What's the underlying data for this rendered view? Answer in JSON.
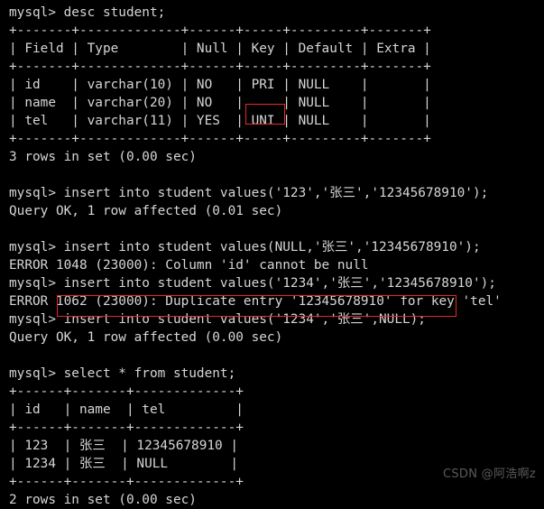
{
  "terminal": {
    "prompt": "mysql>",
    "background_color": "#000000",
    "text_color": "#d6d6d6",
    "annotation_color": "#e8262a",
    "lines": [
      "mysql> desc student;",
      "+-------+-------------+------+-----+---------+-------+",
      "| Field | Type        | Null | Key | Default | Extra |",
      "+-------+-------------+------+-----+---------+-------+",
      "| id    | varchar(10) | NO   | PRI | NULL    |       |",
      "| name  | varchar(20) | NO   |     | NULL    |       |",
      "| tel   | varchar(11) | YES  | UNI | NULL    |       |",
      "+-------+-------------+------+-----+---------+-------+",
      "3 rows in set (0.00 sec)",
      "",
      "mysql> insert into student values('123','张三','12345678910');",
      "Query OK, 1 row affected (0.01 sec)",
      "",
      "mysql> insert into student values(NULL,'张三','12345678910');",
      "ERROR 1048 (23000): Column 'id' cannot be null",
      "mysql> insert into student values('1234','张三','12345678910');",
      "ERROR 1062 (23000): Duplicate entry '12345678910' for key 'tel'",
      "mysql> insert into student values('1234','张三',NULL);",
      "Query OK, 1 row affected (0.00 sec)",
      "",
      "mysql> select * from student;",
      "+------+-------+-------------+",
      "| id   | name  | tel         |",
      "+------+-------+-------------+",
      "| 123  | 张三  | 12345678910 |",
      "| 1234 | 张三  | NULL        |",
      "+------+-------+-------------+",
      "2 rows in set (0.00 sec)"
    ]
  },
  "annotations": [
    {
      "name": "uni-key-highlight",
      "target_text": "UNI"
    },
    {
      "name": "insert-null-tel-highlight",
      "target_text": "insert into student values('1234','张三',NULL);"
    }
  ],
  "watermark": {
    "text": "CSDN @阿浩啊z"
  },
  "sql_session": {
    "describe_table": {
      "statement": "desc student;",
      "columns": [
        "Field",
        "Type",
        "Null",
        "Key",
        "Default",
        "Extra"
      ],
      "rows": [
        [
          "id",
          "varchar(10)",
          "NO",
          "PRI",
          "NULL",
          ""
        ],
        [
          "name",
          "varchar(20)",
          "NO",
          "",
          "NULL",
          ""
        ],
        [
          "tel",
          "varchar(11)",
          "YES",
          "UNI",
          "NULL",
          ""
        ]
      ],
      "result_summary": "3 rows in set (0.00 sec)"
    },
    "inserts": [
      {
        "statement": "insert into student values('123','张三','12345678910');",
        "result": "Query OK, 1 row affected (0.01 sec)"
      },
      {
        "statement": "insert into student values(NULL,'张三','12345678910');",
        "result": "ERROR 1048 (23000): Column 'id' cannot be null"
      },
      {
        "statement": "insert into student values('1234','张三','12345678910');",
        "result": "ERROR 1062 (23000): Duplicate entry '12345678910' for key 'tel'"
      },
      {
        "statement": "insert into student values('1234','张三',NULL);",
        "result": "Query OK, 1 row affected (0.00 sec)"
      }
    ],
    "select_table": {
      "statement": "select * from student;",
      "columns": [
        "id",
        "name",
        "tel"
      ],
      "rows": [
        [
          "123",
          "张三",
          "12345678910"
        ],
        [
          "1234",
          "张三",
          "NULL"
        ]
      ],
      "result_summary": "2 rows in set (0.00 sec)"
    }
  }
}
